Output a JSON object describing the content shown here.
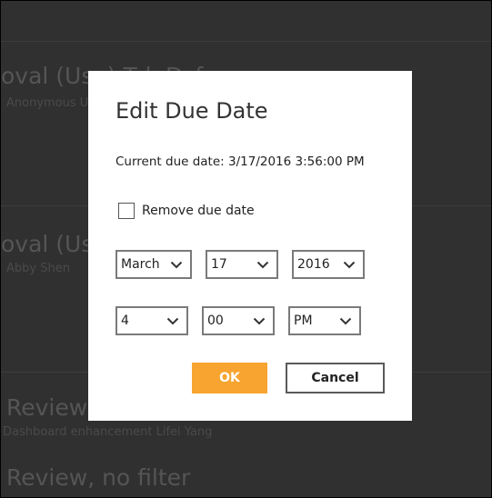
{
  "background": {
    "rows": [
      {
        "title": "oval (Use) Tsk Dsf",
        "subtitle": "Anonymous U"
      },
      {
        "title": "oval (Use",
        "subtitle": "Abby Shen"
      },
      {
        "title": "Review,",
        "subtitle": "Dashboard enhancement Lifei Yang"
      },
      {
        "title": "Review, no filter",
        "subtitle": ""
      }
    ]
  },
  "dialog": {
    "title": "Edit Due Date",
    "current_due": "Current due date: 3/17/2016 3:56:00 PM",
    "remove_label": "Remove due date",
    "remove_checked": false,
    "month": "March",
    "day": "17",
    "year": "2016",
    "hour": "4",
    "minute": "00",
    "ampm": "PM",
    "ok_label": "OK",
    "cancel_label": "Cancel",
    "chevron_icon": "chevron-down-icon"
  },
  "colors": {
    "accent": "#f7a430",
    "dialog_bg": "#ffffff",
    "overlay": "#303030"
  }
}
